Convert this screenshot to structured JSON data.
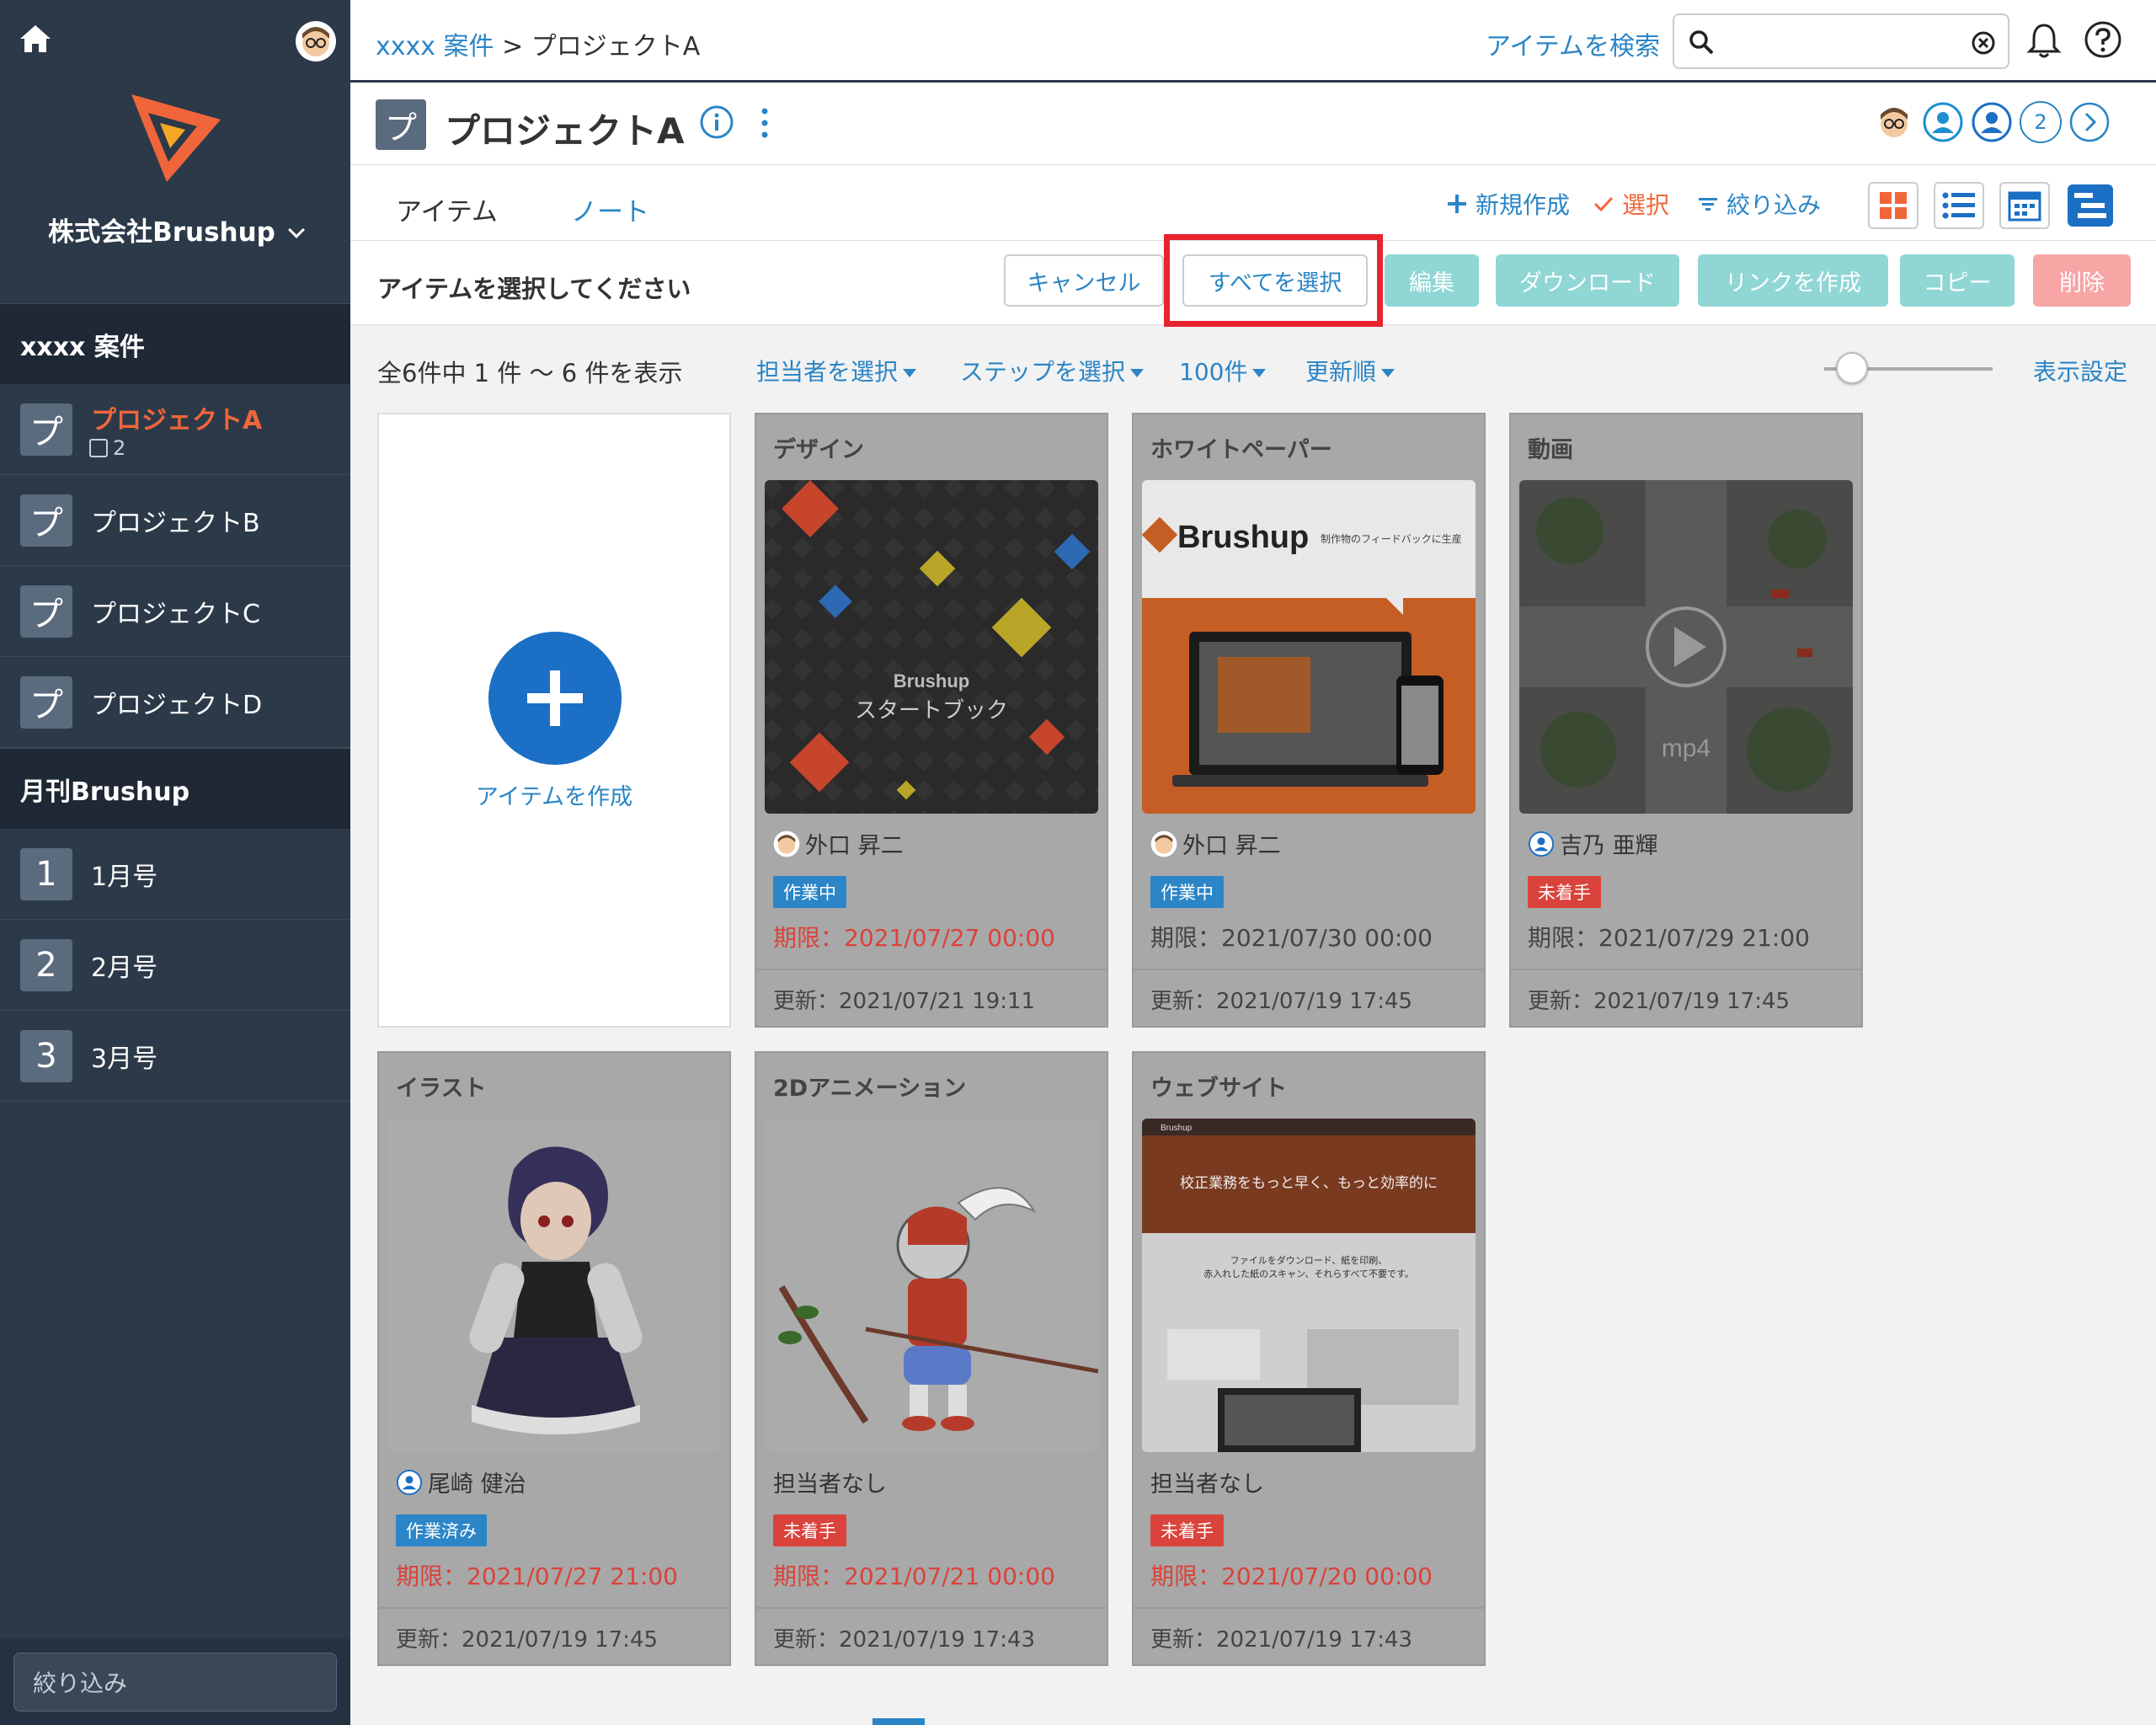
{
  "sidebar": {
    "company": "株式会社Brushup",
    "sections": [
      {
        "title": "xxxx 案件",
        "items": [
          {
            "badge": "プ",
            "label": "プロジェクトA",
            "sub": "2",
            "active": true
          },
          {
            "badge": "プ",
            "label": "プロジェクトB"
          },
          {
            "badge": "プ",
            "label": "プロジェクトC"
          },
          {
            "badge": "プ",
            "label": "プロジェクトD"
          }
        ]
      },
      {
        "title": "月刊Brushup",
        "items": [
          {
            "badge": "1",
            "label": "1月号"
          },
          {
            "badge": "2",
            "label": "2月号"
          },
          {
            "badge": "3",
            "label": "3月号"
          }
        ]
      }
    ],
    "filter_placeholder": "絞り込み"
  },
  "header": {
    "breadcrumb_link": "xxxx 案件",
    "breadcrumb_sep": ">",
    "breadcrumb_current": "プロジェクトA",
    "search_link": "アイテムを検索",
    "search_value": ""
  },
  "project": {
    "badge": "プ",
    "title": "プロジェクトA",
    "member_count": "2"
  },
  "tabs": [
    {
      "label": "アイテム",
      "active": true
    },
    {
      "label": "ノート",
      "active": false
    }
  ],
  "actions": {
    "new": "新規作成",
    "select": "選択",
    "filter": "絞り込み"
  },
  "selection": {
    "message": "アイテムを選択してください",
    "cancel": "キャンセル",
    "select_all": "すべてを選択",
    "edit": "編集",
    "download": "ダウンロード",
    "create_link": "リンクを作成",
    "copy": "コピー",
    "delete": "削除"
  },
  "listbar": {
    "count": "全6件中 1 件 〜 6 件を表示",
    "assignee": "担当者を選択",
    "step": "ステップを選択",
    "per_page": "100件",
    "sort": "更新順",
    "display_settings": "表示設定"
  },
  "create_card": {
    "label": "アイテムを作成"
  },
  "cards": [
    {
      "title": "デザイン",
      "assignee": "外口 昇二",
      "status": "作業中",
      "status_color": "#2b85c6",
      "deadline": "期限：2021/07/27 00:00",
      "deadline_red": true,
      "updated": "更新：2021/07/21 19:11",
      "thumb": "design",
      "thumb_brand": "Brushup",
      "thumb_text": "スタートブック"
    },
    {
      "title": "ホワイトペーパー",
      "assignee": "外口 昇二",
      "status": "作業中",
      "status_color": "#2b85c6",
      "deadline": "期限：2021/07/30 00:00",
      "deadline_red": false,
      "updated": "更新：2021/07/19 17:45",
      "thumb": "whitepaper",
      "thumb_brand": "Brushup",
      "thumb_text": "制作物のフィードバックに生産"
    },
    {
      "title": "動画",
      "assignee": "吉乃 亜輝",
      "status": "未着手",
      "status_color": "#d9433b",
      "deadline": "期限：2021/07/29 21:00",
      "deadline_red": false,
      "updated": "更新：2021/07/19 17:45",
      "thumb": "video",
      "thumb_text": "mp4"
    },
    {
      "title": "イラスト",
      "assignee": "尾崎 健治",
      "status": "作業済み",
      "status_color": "#2b85c6",
      "deadline": "期限：2021/07/27 21:00",
      "deadline_red": true,
      "updated": "更新：2021/07/19 17:45",
      "thumb": "illust"
    },
    {
      "title": "2Dアニメーション",
      "assignee": "担当者なし",
      "status": "未着手",
      "status_color": "#d9433b",
      "deadline": "期限：2021/07/21 00:00",
      "deadline_red": true,
      "updated": "更新：2021/07/19 17:43",
      "thumb": "anim"
    },
    {
      "title": "ウェブサイト",
      "assignee": "担当者なし",
      "status": "未着手",
      "status_color": "#d9433b",
      "deadline": "期限：2021/07/20 00:00",
      "deadline_red": true,
      "updated": "更新：2021/07/19 17:43",
      "thumb": "website",
      "thumb_brand": "Brushup",
      "thumb_text": "校正業務をもっと早く、もっと効率的に",
      "thumb_text2": "ファイルをダウンロード、紙を印刷、",
      "thumb_text3": "赤入れした紙のスキャン、それらすべて不要です。"
    }
  ],
  "colors": {
    "accent": "#2b85c6",
    "brand_orange": "#f0663a",
    "sidebar_bg": "#2c3949",
    "highlight": "#e8242f"
  }
}
